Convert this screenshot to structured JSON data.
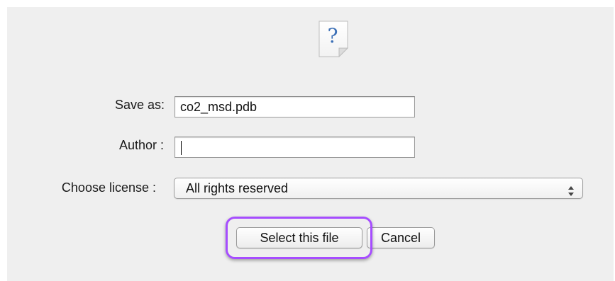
{
  "form": {
    "save_as_label": "Save as:",
    "save_as_value": "co2_msd.pdb",
    "author_label": "Author :",
    "author_value": "",
    "license_label": "Choose license :",
    "license_selected": "All rights reserved"
  },
  "buttons": {
    "select_label": "Select this file",
    "cancel_label": "Cancel"
  },
  "icons": {
    "file_icon": "unknown-file-icon",
    "file_icon_glyph": "?",
    "select_arrows": "up-down-arrows-icon"
  },
  "colors": {
    "dialog_background": "#efefef",
    "highlight": "#a64dff",
    "question_mark": "#3b6fb6"
  }
}
